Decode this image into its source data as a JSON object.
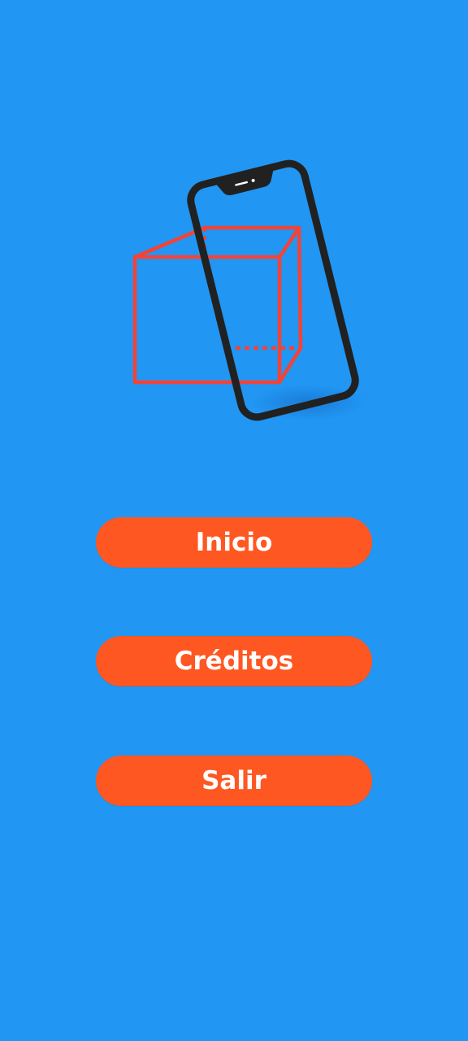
{
  "colors": {
    "background": "#2196F3",
    "button": "#FF5722",
    "button_text": "#FFFFFF",
    "cube": "#F44336",
    "phone_frame": "#212121"
  },
  "logo": {
    "icon": "cube-in-phone-ar-icon"
  },
  "menu": {
    "start_label": "Inicio",
    "credits_label": "Créditos",
    "exit_label": "Salir"
  }
}
